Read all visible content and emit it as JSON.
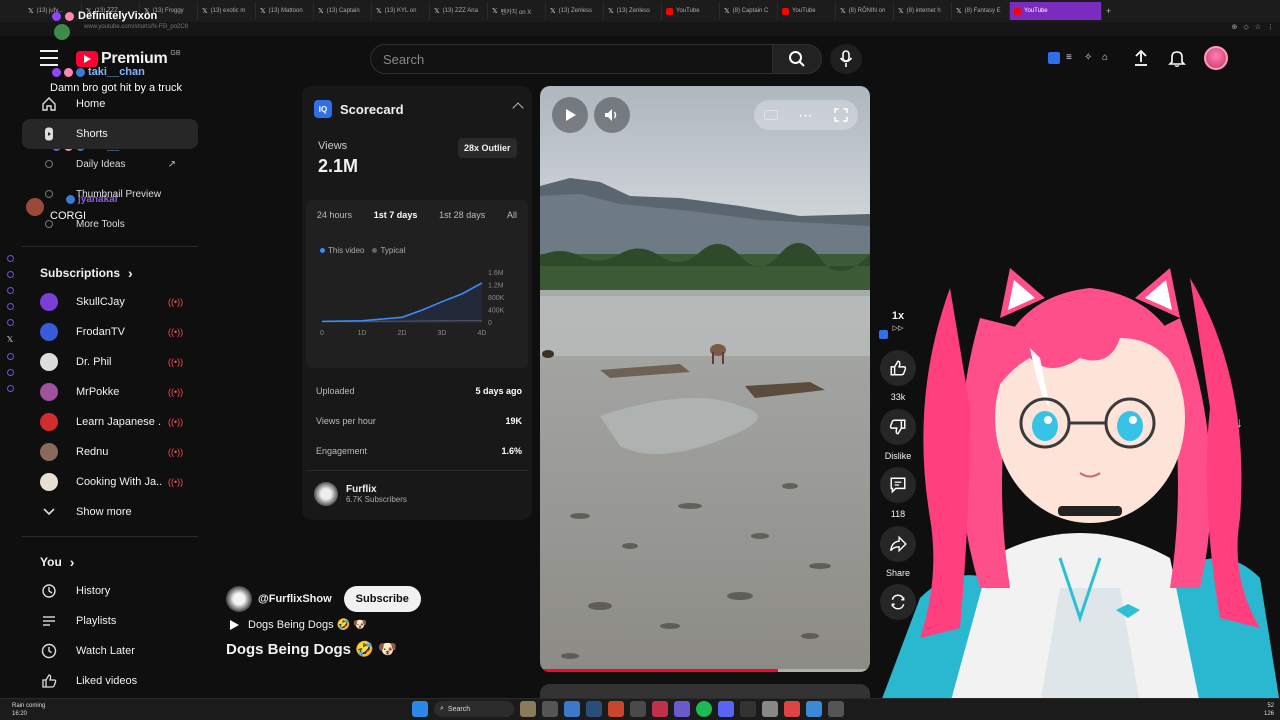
{
  "browser": {
    "tabs": [
      {
        "label": "(13) jufy...",
        "icon": "x"
      },
      {
        "label": "(13) ZZZ...",
        "icon": "x"
      },
      {
        "label": "(13) Froggy",
        "icon": "x"
      },
      {
        "label": "(13) exotic m",
        "icon": "x"
      },
      {
        "label": "(13) Mattoon",
        "icon": "x"
      },
      {
        "label": "(13) Captain",
        "icon": "x"
      },
      {
        "label": "(13) KYL on",
        "icon": "x"
      },
      {
        "label": "(13) ZZZ Ana",
        "icon": "x"
      },
      {
        "label": "펜카치 on X",
        "icon": "x"
      },
      {
        "label": "(13) Zenless",
        "icon": "x"
      },
      {
        "label": "(13) Zenless",
        "icon": "x"
      },
      {
        "label": "YouTube",
        "icon": "yt"
      },
      {
        "label": "(8) Captain C",
        "icon": "x"
      },
      {
        "label": "YouTube",
        "icon": "yt"
      },
      {
        "label": "(8) RŌNIN on",
        "icon": "x"
      },
      {
        "label": "(8) internet h",
        "icon": "x"
      },
      {
        "label": "(8) Fantasy E",
        "icon": "x"
      },
      {
        "label": "YouTube",
        "icon": "yt"
      }
    ],
    "active_tab": "YouTube",
    "address": "www.youtube.com/shorts/N-F5l_po2C8"
  },
  "header": {
    "logo_text": "Premium",
    "country": "GB",
    "search_placeholder": "Search"
  },
  "chat": {
    "message_1": {
      "user": "DefinitelyVixon"
    },
    "message_2": {
      "user": "taki__chan",
      "text": "Damn bro got hit by a truck"
    },
    "message_3": {
      "user": "taki__chan"
    },
    "message_4": {
      "user": "jyanakal",
      "text": "CORGI"
    }
  },
  "sidebar": {
    "nav": [
      {
        "label": "Home",
        "icon": "home-icon"
      },
      {
        "label": "Shorts",
        "icon": "shorts-icon"
      }
    ],
    "extension_items": [
      {
        "label": "Daily Ideas"
      },
      {
        "label": "Thumbnail Preview"
      },
      {
        "label": "More Tools"
      }
    ],
    "subscriptions_title": "Subscriptions",
    "subscriptions": [
      {
        "name": "SkullCJay",
        "color": "#7a3fd6"
      },
      {
        "name": "FrodanTV",
        "color": "#3a5bd9"
      },
      {
        "name": "Dr. Phil",
        "color": "#dddddd"
      },
      {
        "name": "MrPokke",
        "color": "#a0529a"
      },
      {
        "name": "Learn Japanese ...",
        "color": "#d22d2d"
      },
      {
        "name": "Rednu",
        "color": "#8a6a5a"
      },
      {
        "name": "Cooking With Ja...",
        "color": "#e8e0d0"
      }
    ],
    "show_more": "Show more",
    "you_title": "You",
    "you_items": [
      {
        "label": "History",
        "icon": "history-icon"
      },
      {
        "label": "Playlists",
        "icon": "playlists-icon"
      },
      {
        "label": "Watch Later",
        "icon": "watch-later-icon"
      },
      {
        "label": "Liked videos",
        "icon": "like-icon"
      }
    ]
  },
  "scorecard": {
    "title": "Scorecard",
    "views_label": "Views",
    "views_value": "2.1M",
    "outlier": "28x Outlier",
    "ranges": [
      "24 hours",
      "1st 7 days",
      "1st 28 days",
      "All"
    ],
    "active_range": "1st 7 days",
    "legend_this": "This video",
    "legend_typical": "Typical",
    "stats": [
      {
        "label": "Uploaded",
        "value": "5 days ago"
      },
      {
        "label": "Views per hour",
        "value": "19K"
      },
      {
        "label": "Engagement",
        "value": "1.6%"
      }
    ],
    "channel_name": "Furflix",
    "channel_subs": "6.7K Subscribers",
    "accent": "#2f6feb"
  },
  "chart_data": {
    "type": "line",
    "x_ticks": [
      "0",
      "1D",
      "2D",
      "3D",
      "4D"
    ],
    "y_ticks": [
      "1.6M",
      "1.2M",
      "800K",
      "400K",
      "0"
    ],
    "ylim": [
      0,
      1600000
    ],
    "series": [
      {
        "name": "This video",
        "x": [
          0,
          1,
          2,
          2.5,
          3,
          3.5,
          4
        ],
        "y": [
          20000,
          40000,
          150000,
          380000,
          650000,
          900000,
          1250000
        ]
      },
      {
        "name": "Typical",
        "x": [
          0,
          1,
          2,
          3,
          4
        ],
        "y": [
          10000,
          20000,
          30000,
          40000,
          50000
        ]
      }
    ]
  },
  "video": {
    "progress": 0.72,
    "speed": "1x",
    "likes": "33k",
    "dislike_label": "Dislike",
    "comments": "118",
    "share_label": "Share",
    "channel_handle": "@FurflixShow",
    "subscribe_label": "Subscribe",
    "playlist_label": "Dogs Being Dogs 🤣 🐶",
    "title": "Dogs Being Dogs 🤣 🐶"
  },
  "taskbar": {
    "weather_line1": "Rain coming",
    "weather_line2": "16:20",
    "search_label": "Search",
    "clock_line1": "52",
    "clock_line2": "126"
  }
}
